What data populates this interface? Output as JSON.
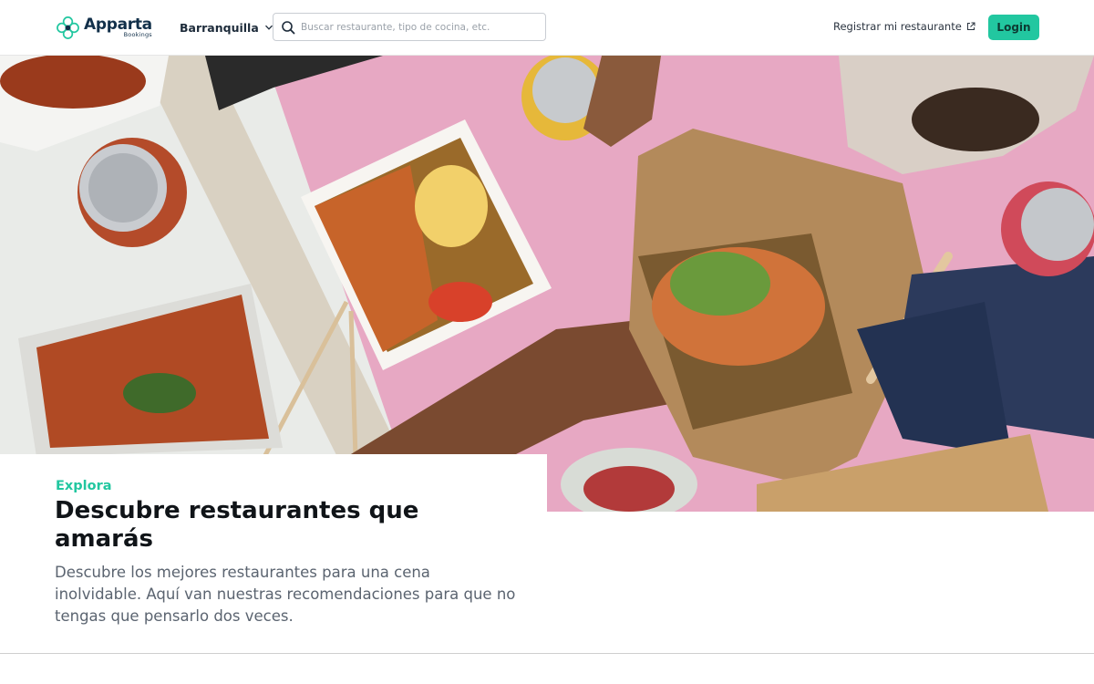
{
  "header": {
    "brand": {
      "name": "Apparta",
      "sub": "Bookings",
      "icon": "apparta-logo-icon"
    },
    "city": {
      "label": "Barranquilla",
      "icon": "chevron-down-icon"
    },
    "search": {
      "placeholder": "Buscar restaurante, tipo de cocina, etc.",
      "value": "",
      "icon": "search-icon"
    },
    "register": {
      "label": "Registrar mi restaurante",
      "icon": "external-link-icon"
    },
    "login_label": "Login"
  },
  "hero": {
    "image": "food-table-photo",
    "eyebrow": "Explora",
    "title": "Descubre restaurantes que amarás",
    "description": "Descubre los mejores restaurantes para una cena inolvidable. Aquí van nuestras recomendaciones para que no tengas que pensarlo dos veces."
  },
  "colors": {
    "accent": "#22c7a0",
    "brand_dark": "#12304a",
    "text_muted": "#5b6470"
  }
}
